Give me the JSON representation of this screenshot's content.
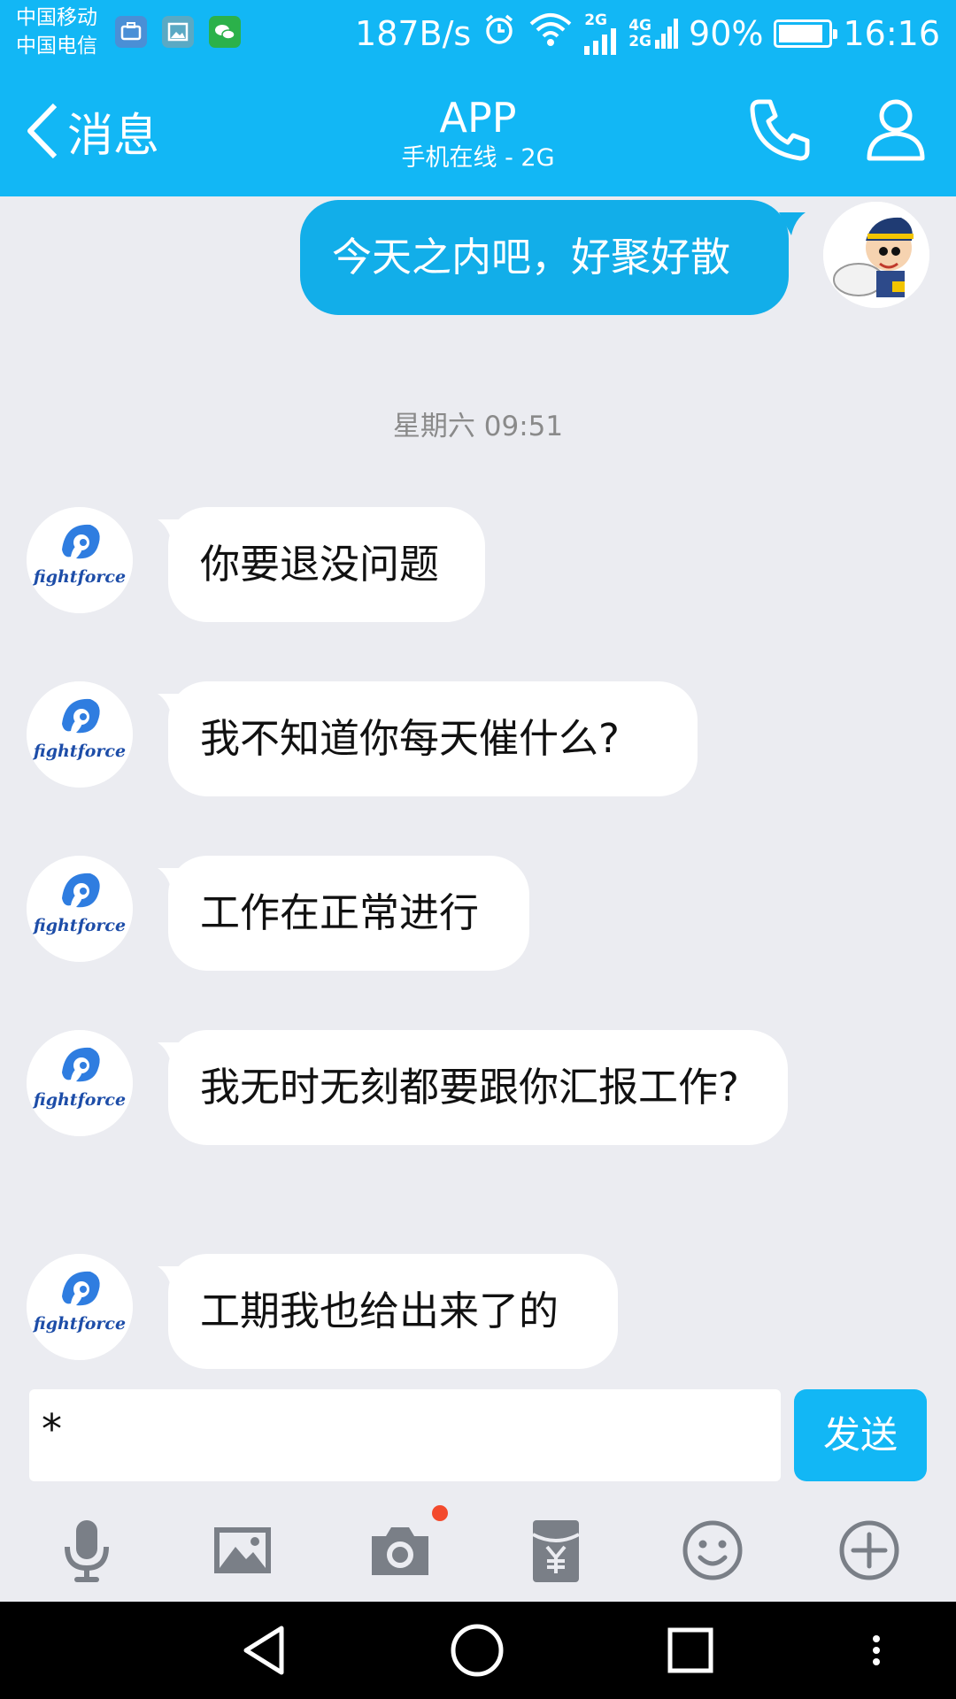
{
  "status_bar": {
    "carrier_1": "中国移动",
    "carrier_2": "中国电信",
    "net_speed": "187B/s",
    "sim1_net": "2G",
    "sim2_net_top": "4G",
    "sim2_net_bottom": "2G",
    "battery": "90%",
    "battery_level": 0.9,
    "time": "16:16"
  },
  "header": {
    "back_label": "消息",
    "title": "APP",
    "subtitle": "手机在线 - 2G",
    "icons": [
      "phone-icon",
      "contact-profile-icon"
    ]
  },
  "conversation": {
    "outgoing": {
      "text": "今天之内吧，好聚好散"
    },
    "timestamp": "星期六 09:51",
    "contact_logo_text": "fightforce",
    "incoming": [
      {
        "text": "你要退没问题"
      },
      {
        "text": "我不知道你每天催什么?"
      },
      {
        "text": "工作在正常进行"
      },
      {
        "text": "我无时无刻都要跟你汇报工作?"
      },
      {
        "text": "工期我也给出来了的"
      }
    ]
  },
  "composer": {
    "input_value": "*",
    "send_label": "发送"
  },
  "toolbar": {
    "items": [
      "microphone-icon",
      "image-icon",
      "camera-icon",
      "red-packet-icon",
      "emoji-icon",
      "plus-icon"
    ]
  },
  "colors": {
    "brand": "#12b7f5",
    "outgoing_bubble": "#12aee9",
    "background": "#ebecf1",
    "badge": "#f34a2d"
  }
}
